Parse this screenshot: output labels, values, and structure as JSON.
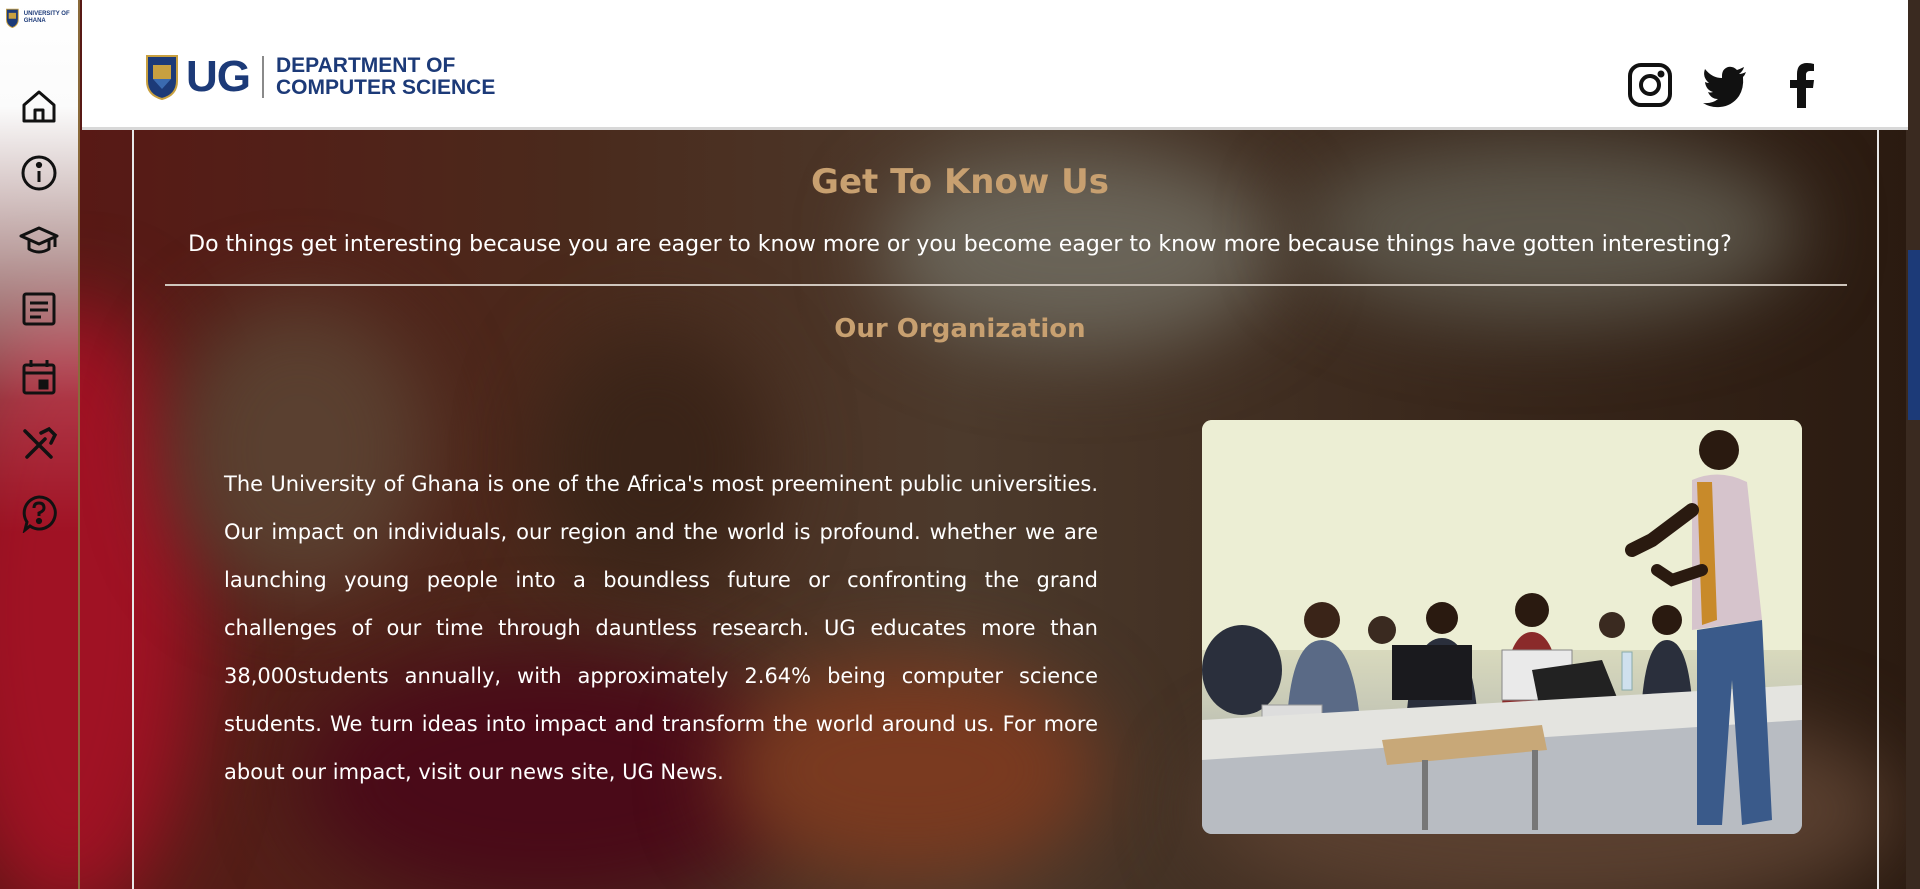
{
  "sidebar": {
    "logo_text": "UNIVERSITY OF GHANA",
    "items": [
      {
        "name": "home",
        "icon": "home-icon"
      },
      {
        "name": "about",
        "icon": "info-icon"
      },
      {
        "name": "academics",
        "icon": "graduation-cap-icon"
      },
      {
        "name": "news",
        "icon": "article-icon"
      },
      {
        "name": "events",
        "icon": "calendar-icon"
      },
      {
        "name": "tools",
        "icon": "tools-icon"
      },
      {
        "name": "help",
        "icon": "help-icon"
      }
    ]
  },
  "header": {
    "logo_ug": "UG",
    "logo_dept_line1": "DEPARTMENT OF",
    "logo_dept_line2": "COMPUTER SCIENCE",
    "social": [
      "instagram-icon",
      "twitter-icon",
      "facebook-icon"
    ]
  },
  "main": {
    "title": "Get To Know Us",
    "subtitle": "Do things get interesting because you are eager to know more or you become eager to know more because things have gotten interesting?",
    "section_title": "Our Organization",
    "body": "The University of Ghana is one of the Africa's most preeminent public universities. Our impact on individuals, our region and the world is profound. whether we are launching young people into a boundless future or confronting the grand challenges of our time through dauntless research. UG educates more than 38,000students annually, with approximately 2.64% being computer science students. We turn ideas into impact and transform the world around us. For more about our impact, visit our news site, UG News."
  },
  "colors": {
    "brand_blue": "#1c3a78",
    "heading_gold": "#c8a070",
    "sidebar_border": "#8a6a3a"
  }
}
